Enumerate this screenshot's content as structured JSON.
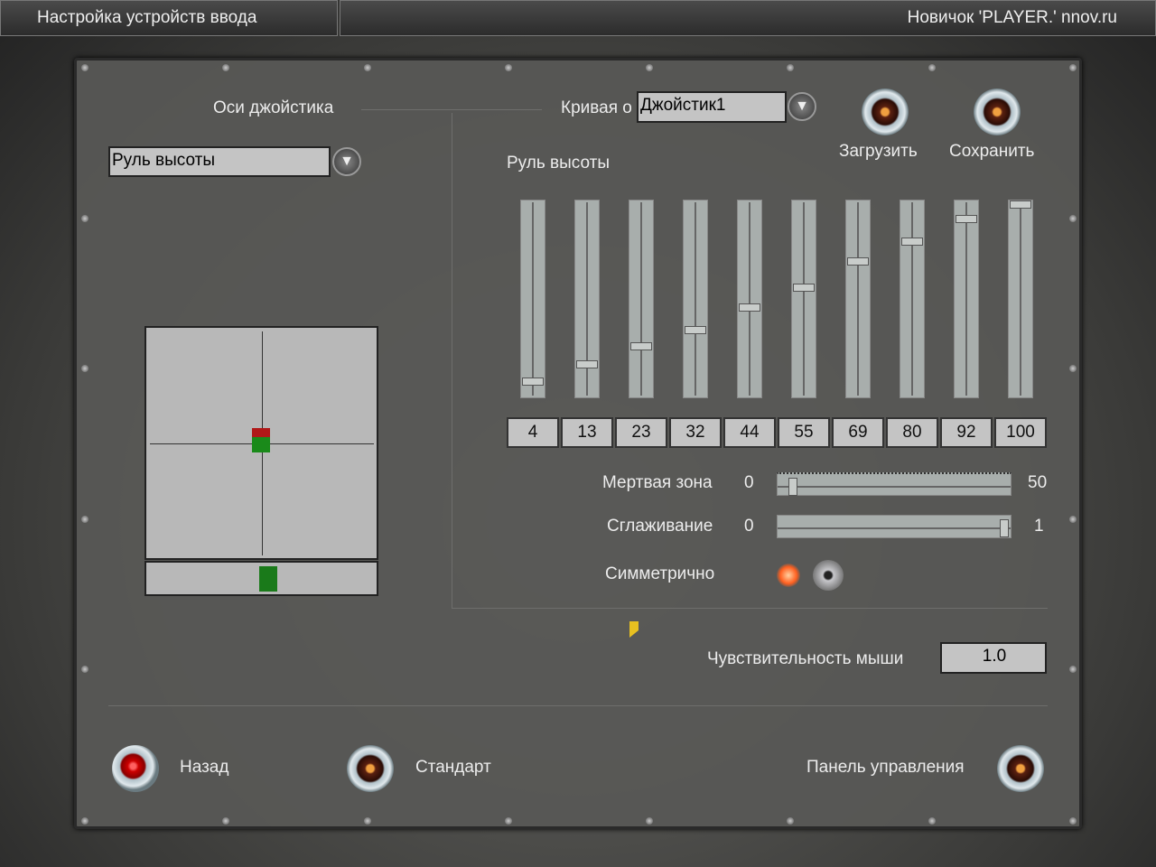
{
  "window": {
    "title": "Настройка устройств ввода",
    "user": "Новичок 'PLAYER.' nnov.ru"
  },
  "left": {
    "section_title": "Оси джойстика",
    "axis_select": "Руль высоты"
  },
  "right": {
    "curve_label": "Кривая о",
    "device_select": "Джойстик1",
    "axis_name": "Руль высоты",
    "load_label": "Загрузить",
    "save_label": "Сохранить",
    "curve_values": [
      "4",
      "13",
      "23",
      "32",
      "44",
      "55",
      "69",
      "80",
      "92",
      "100"
    ],
    "deadzone": {
      "label": "Мертвая зона",
      "min": "0",
      "max": "50",
      "value": 2
    },
    "smoothing": {
      "label": "Сглаживание",
      "min": "0",
      "max": "1",
      "value": 1
    },
    "symmetric": {
      "label": "Симметрично",
      "on": true
    },
    "mouse_sensitivity": {
      "label": "Чувствительность мыши",
      "value": "1.0"
    }
  },
  "footer": {
    "back": "Назад",
    "default": "Стандарт",
    "control_panel": "Панель управления"
  }
}
